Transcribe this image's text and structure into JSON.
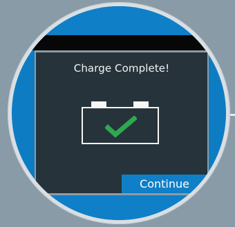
{
  "screen": {
    "title": "Charge Complete!",
    "status_icon": "battery-full-check-icon",
    "continue_label": "Continue"
  },
  "colors": {
    "accent_blue": "#0f7fc8",
    "screen_bg": "#27333a",
    "check_green": "#2fa84f"
  }
}
